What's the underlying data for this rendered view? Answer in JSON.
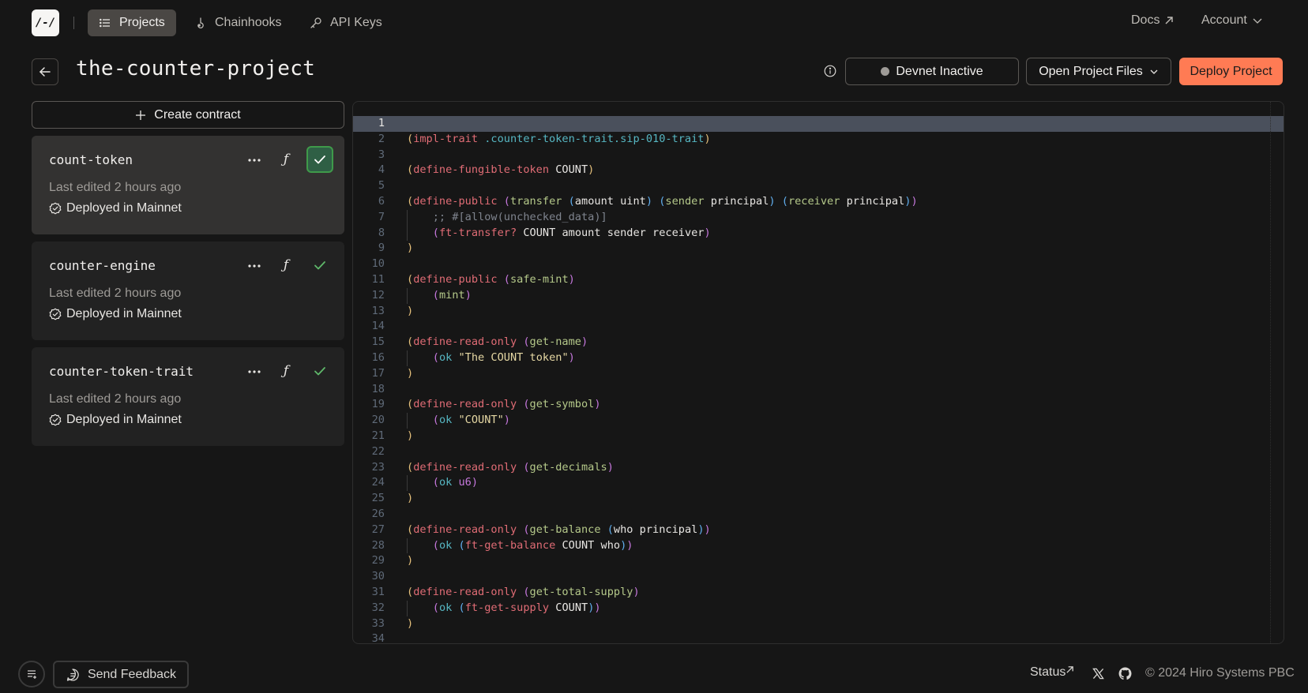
{
  "nav": {
    "logo": "/-/",
    "items": [
      {
        "label": "Projects",
        "icon": "list-icon",
        "active": true
      },
      {
        "label": "Chainhooks",
        "icon": "hook-icon",
        "active": false
      },
      {
        "label": "API Keys",
        "icon": "key-icon",
        "active": false
      }
    ],
    "docs_label": "Docs",
    "account_label": "Account"
  },
  "header": {
    "project_title": "the-counter-project",
    "devnet_status": "Devnet Inactive",
    "open_files_label": "Open Project Files",
    "deploy_label": "Deploy Project"
  },
  "sidebar": {
    "create_label": "Create contract",
    "contracts": [
      {
        "name": "count-token",
        "edited": "Last edited 2 hours ago",
        "status": "Deployed in Mainnet",
        "selected": true
      },
      {
        "name": "counter-engine",
        "edited": "Last edited 2 hours ago",
        "status": "Deployed in Mainnet",
        "selected": false
      },
      {
        "name": "counter-token-trait",
        "edited": "Last edited 2 hours ago",
        "status": "Deployed in Mainnet",
        "selected": false
      }
    ]
  },
  "editor": {
    "current_line": 1,
    "lines": [
      [],
      [
        [
          "p1",
          "("
        ],
        [
          "kw",
          "impl-trait"
        ],
        [
          "id",
          " "
        ],
        [
          "ref",
          ".counter-token-trait.sip-010-trait"
        ],
        [
          "p1",
          ")"
        ]
      ],
      [],
      [
        [
          "p1",
          "("
        ],
        [
          "kw",
          "define-fungible-token"
        ],
        [
          "id",
          " COUNT"
        ],
        [
          "p1",
          ")"
        ]
      ],
      [],
      [
        [
          "p1",
          "("
        ],
        [
          "kw",
          "define-public"
        ],
        [
          "id",
          " "
        ],
        [
          "p2",
          "("
        ],
        [
          "fn",
          "transfer"
        ],
        [
          "id",
          " "
        ],
        [
          "p3",
          "("
        ],
        [
          "id",
          "amount uint"
        ],
        [
          "p3",
          ")"
        ],
        [
          "id",
          " "
        ],
        [
          "p3",
          "("
        ],
        [
          "fn",
          "sender"
        ],
        [
          "id",
          " principal"
        ],
        [
          "p3",
          ")"
        ],
        [
          "id",
          " "
        ],
        [
          "p3",
          "("
        ],
        [
          "fn",
          "receiver"
        ],
        [
          "id",
          " principal"
        ],
        [
          "p3",
          ")"
        ],
        [
          "p2",
          ")"
        ]
      ],
      [
        [
          "id",
          "    "
        ],
        [
          "cmt",
          ";; #[allow(unchecked_data)]"
        ]
      ],
      [
        [
          "id",
          "    "
        ],
        [
          "p2",
          "("
        ],
        [
          "kw",
          "ft-transfer?"
        ],
        [
          "id",
          " COUNT amount sender receiver"
        ],
        [
          "p2",
          ")"
        ]
      ],
      [
        [
          "p1",
          ")"
        ]
      ],
      [],
      [
        [
          "p1",
          "("
        ],
        [
          "kw",
          "define-public"
        ],
        [
          "id",
          " "
        ],
        [
          "p2",
          "("
        ],
        [
          "fn",
          "safe-mint"
        ],
        [
          "p2",
          ")"
        ]
      ],
      [
        [
          "id",
          "    "
        ],
        [
          "p2",
          "("
        ],
        [
          "fn",
          "mint"
        ],
        [
          "p2",
          ")"
        ]
      ],
      [
        [
          "p1",
          ")"
        ]
      ],
      [],
      [
        [
          "p1",
          "("
        ],
        [
          "kw",
          "define-read-only"
        ],
        [
          "id",
          " "
        ],
        [
          "p2",
          "("
        ],
        [
          "fn",
          "get-name"
        ],
        [
          "p2",
          ")"
        ]
      ],
      [
        [
          "id",
          "    "
        ],
        [
          "p2",
          "("
        ],
        [
          "bi",
          "ok"
        ],
        [
          "id",
          " "
        ],
        [
          "str",
          "\"The COUNT token\""
        ],
        [
          "p2",
          ")"
        ]
      ],
      [
        [
          "p1",
          ")"
        ]
      ],
      [],
      [
        [
          "p1",
          "("
        ],
        [
          "kw",
          "define-read-only"
        ],
        [
          "id",
          " "
        ],
        [
          "p2",
          "("
        ],
        [
          "fn",
          "get-symbol"
        ],
        [
          "p2",
          ")"
        ]
      ],
      [
        [
          "id",
          "    "
        ],
        [
          "p2",
          "("
        ],
        [
          "bi",
          "ok"
        ],
        [
          "id",
          " "
        ],
        [
          "str",
          "\"COUNT\""
        ],
        [
          "p2",
          ")"
        ]
      ],
      [
        [
          "p1",
          ")"
        ]
      ],
      [],
      [
        [
          "p1",
          "("
        ],
        [
          "kw",
          "define-read-only"
        ],
        [
          "id",
          " "
        ],
        [
          "p2",
          "("
        ],
        [
          "fn",
          "get-decimals"
        ],
        [
          "p2",
          ")"
        ]
      ],
      [
        [
          "id",
          "    "
        ],
        [
          "p2",
          "("
        ],
        [
          "bi",
          "ok"
        ],
        [
          "id",
          " "
        ],
        [
          "num",
          "u6"
        ],
        [
          "p2",
          ")"
        ]
      ],
      [
        [
          "p1",
          ")"
        ]
      ],
      [],
      [
        [
          "p1",
          "("
        ],
        [
          "kw",
          "define-read-only"
        ],
        [
          "id",
          " "
        ],
        [
          "p2",
          "("
        ],
        [
          "fn",
          "get-balance"
        ],
        [
          "id",
          " "
        ],
        [
          "p3",
          "("
        ],
        [
          "id",
          "who principal"
        ],
        [
          "p3",
          ")"
        ],
        [
          "p2",
          ")"
        ]
      ],
      [
        [
          "id",
          "    "
        ],
        [
          "p2",
          "("
        ],
        [
          "bi",
          "ok"
        ],
        [
          "id",
          " "
        ],
        [
          "p3",
          "("
        ],
        [
          "kw",
          "ft-get-balance"
        ],
        [
          "id",
          " COUNT who"
        ],
        [
          "p3",
          ")"
        ],
        [
          "p2",
          ")"
        ]
      ],
      [
        [
          "p1",
          ")"
        ]
      ],
      [],
      [
        [
          "p1",
          "("
        ],
        [
          "kw",
          "define-read-only"
        ],
        [
          "id",
          " "
        ],
        [
          "p2",
          "("
        ],
        [
          "fn",
          "get-total-supply"
        ],
        [
          "p2",
          ")"
        ]
      ],
      [
        [
          "id",
          "    "
        ],
        [
          "p2",
          "("
        ],
        [
          "bi",
          "ok"
        ],
        [
          "id",
          " "
        ],
        [
          "p3",
          "("
        ],
        [
          "kw",
          "ft-get-supply"
        ],
        [
          "id",
          " COUNT"
        ],
        [
          "p3",
          ")"
        ],
        [
          "p2",
          ")"
        ]
      ],
      [
        [
          "p1",
          ")"
        ]
      ],
      []
    ]
  },
  "footer": {
    "feedback_label": "Send Feedback",
    "status_label": "Status",
    "copyright": "© 2024 Hiro Systems PBC"
  }
}
